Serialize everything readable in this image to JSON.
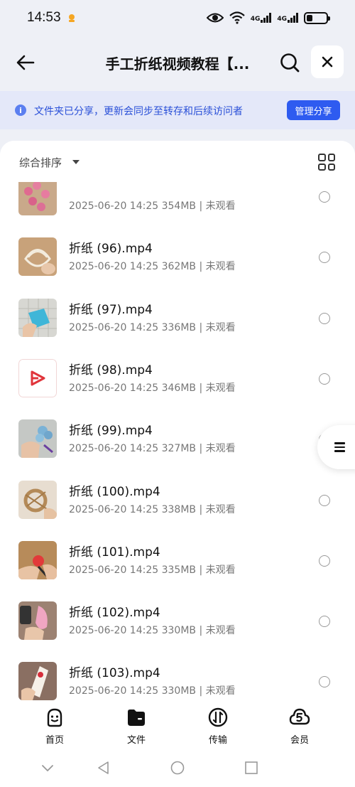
{
  "status_bar": {
    "time": "14:53",
    "network_1": "4G",
    "network_2": "4G",
    "battery_level": 0.3
  },
  "header": {
    "title": "手工折纸视频教程【...",
    "back_icon": "arrow-left-icon",
    "search_icon": "search-icon",
    "close_icon": "close-icon"
  },
  "banner": {
    "text": "文件夹已分享，更新会同步至转存和后续访问者",
    "button": "管理分享",
    "accent": "#2e5bf0"
  },
  "sort": {
    "label": "综合排序"
  },
  "files": [
    {
      "name": "",
      "meta": "2025-06-20 14:25  354MB | 未观看"
    },
    {
      "name": "折纸 (96).mp4",
      "meta": "2025-06-20 14:25  362MB | 未观看"
    },
    {
      "name": "折纸 (97).mp4",
      "meta": "2025-06-20 14:25  336MB | 未观看"
    },
    {
      "name": "折纸 (98).mp4",
      "meta": "2025-06-20 14:25  346MB | 未观看"
    },
    {
      "name": "折纸 (99).mp4",
      "meta": "2025-06-20 14:25  327MB | 未观看"
    },
    {
      "name": "折纸 (100).mp4",
      "meta": "2025-06-20 14:25  338MB | 未观看"
    },
    {
      "name": "折纸 (101).mp4",
      "meta": "2025-06-20 14:25  335MB | 未观看"
    },
    {
      "name": "折纸 (102).mp4",
      "meta": "2025-06-20 14:25  330MB | 未观看"
    },
    {
      "name": "折纸 (103).mp4",
      "meta": "2025-06-20 14:25  330MB | 未观看"
    }
  ],
  "tabs": [
    {
      "label": "首页",
      "icon": "home-face-icon"
    },
    {
      "label": "文件",
      "icon": "folder-icon"
    },
    {
      "label": "传输",
      "icon": "transfer-icon"
    },
    {
      "label": "会员",
      "icon": "vip-cloud-icon"
    }
  ]
}
